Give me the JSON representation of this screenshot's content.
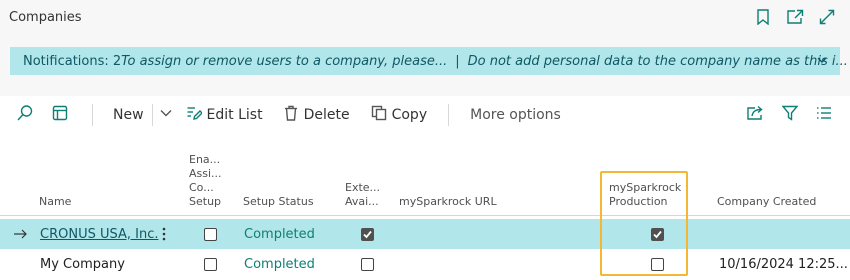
{
  "page": {
    "title": "Companies"
  },
  "top_icons": [
    "bookmark-icon",
    "open-in-new-window-icon",
    "expand-icon"
  ],
  "notification": {
    "count_label": "Notifications: 2",
    "message_1": "To assign or remove users to a company, please...",
    "separator": "|",
    "message_2": "Do not add personal data to the company name as this i..."
  },
  "toolbar": {
    "new_label": "New",
    "edit_list_label": "Edit List",
    "delete_label": "Delete",
    "copy_label": "Copy",
    "more_options_label": "More options"
  },
  "columns": {
    "name": "Name",
    "enable_assisted_setup": [
      "Ena...",
      "Assi...",
      "Co...",
      "Setup"
    ],
    "setup_status": "Setup Status",
    "external_available": [
      "Exte...",
      "Avai..."
    ],
    "mysparkrock_url": "mySparkrock URL",
    "mysparkrock_production": [
      "mySparkrock",
      "Production"
    ],
    "company_created": "Company Created"
  },
  "rows": [
    {
      "name": "CRONUS USA, Inc.",
      "selected": true,
      "assisted_setup": false,
      "setup_status": "Completed",
      "external_available": true,
      "mysparkrock_url": "",
      "mysparkrock_production": true,
      "company_created": ""
    },
    {
      "name": "My Company",
      "selected": false,
      "assisted_setup": false,
      "setup_status": "Completed",
      "external_available": false,
      "mysparkrock_url": "",
      "mysparkrock_production": false,
      "company_created": "10/16/2024 12:25..."
    }
  ],
  "colors": {
    "accent": "#0f7f74",
    "notification_bg": "#b1e6ea",
    "highlight_border": "#f5b731"
  }
}
